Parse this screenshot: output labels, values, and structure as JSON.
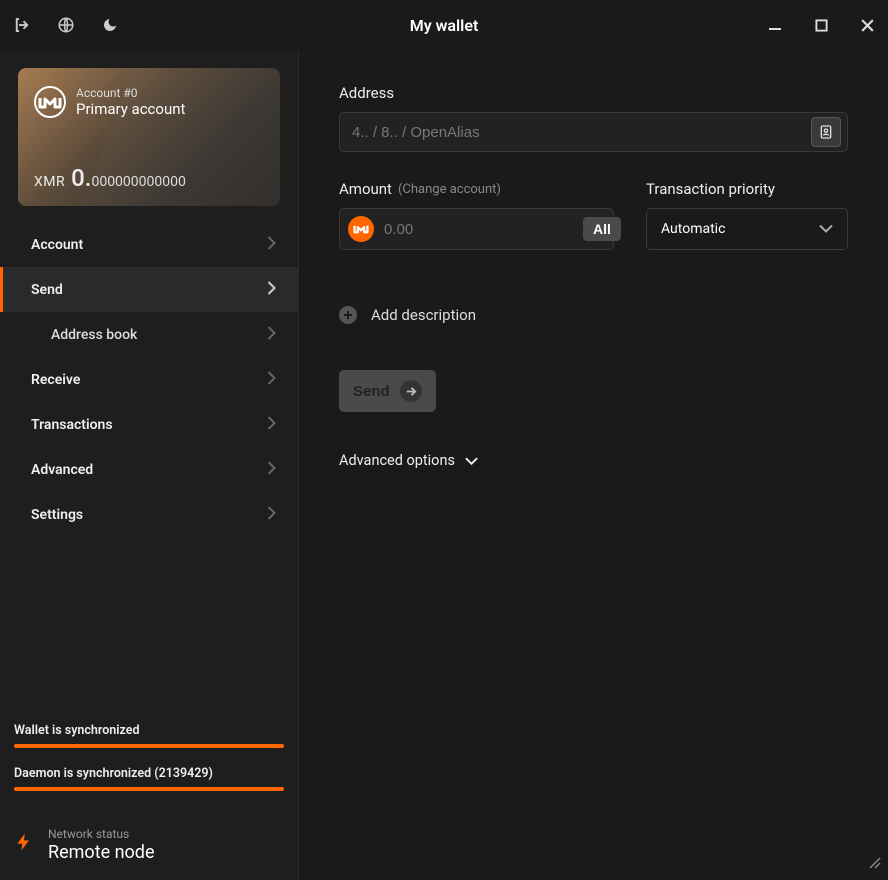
{
  "titlebar": {
    "title": "My wallet"
  },
  "account": {
    "number_label": "Account #0",
    "name": "Primary account",
    "ticker": "XMR",
    "balance_whole": "0.",
    "balance_frac": "000000000000"
  },
  "nav": {
    "account": "Account",
    "send": "Send",
    "address_book": "Address book",
    "receive": "Receive",
    "transactions": "Transactions",
    "advanced": "Advanced",
    "settings": "Settings"
  },
  "sync": {
    "wallet_label": "Wallet is synchronized",
    "daemon_label": "Daemon is synchronized (2139429)"
  },
  "network": {
    "status_label": "Network status",
    "mode": "Remote node"
  },
  "send_form": {
    "address_label": "Address",
    "address_placeholder": "4.. / 8.. / OpenAlias",
    "amount_label": "Amount",
    "amount_hint": "(Change account)",
    "amount_placeholder": "0.00",
    "all_button": "All",
    "priority_label": "Transaction priority",
    "priority_value": "Automatic",
    "add_description": "Add description",
    "send_button": "Send",
    "advanced_options": "Advanced options"
  }
}
